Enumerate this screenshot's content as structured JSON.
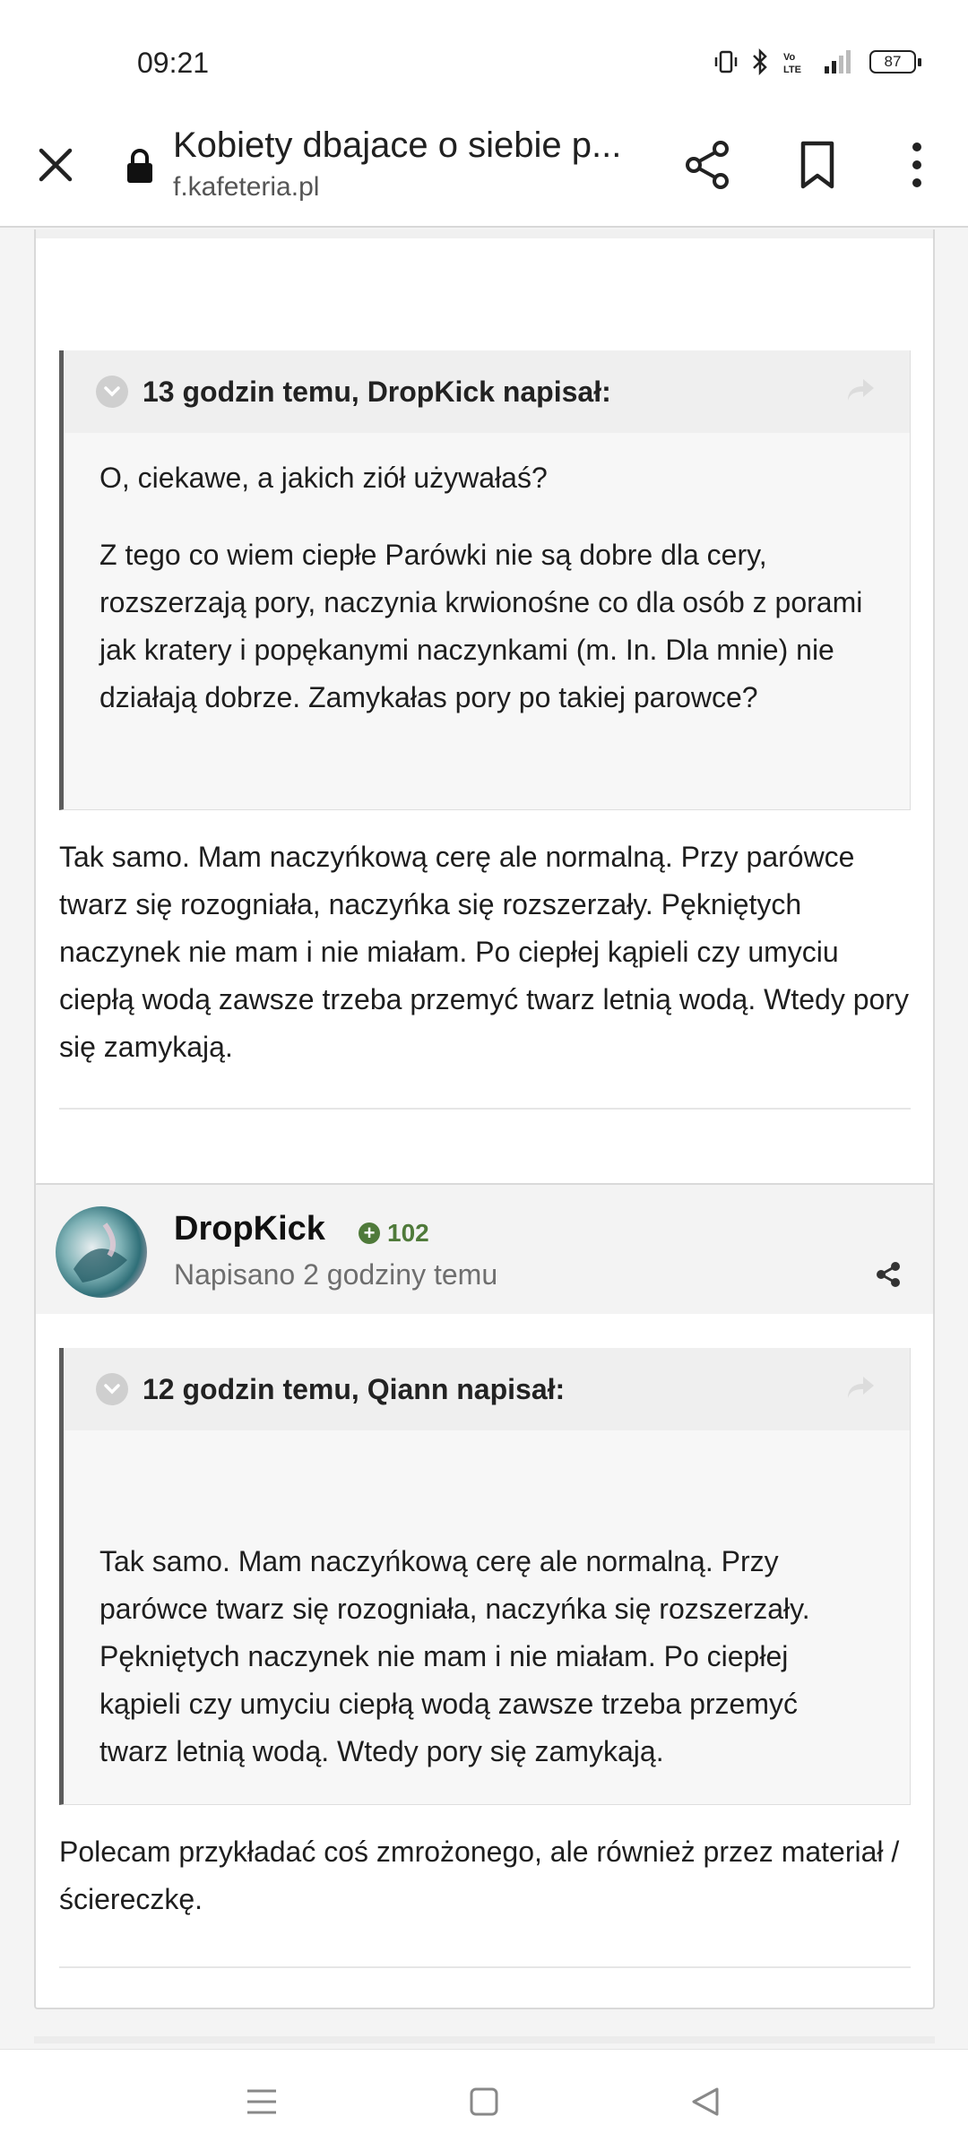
{
  "status": {
    "time": "09:21",
    "battery": "87"
  },
  "browser": {
    "title": "Kobiety dbajace o siebie p...",
    "url": "f.kafeteria.pl"
  },
  "post1": {
    "quote": {
      "citation": "13 godzin temu, DropKick napisał:",
      "paragraphs": [
        "O, ciekawe, a jakich ziół używałaś?",
        "Z tego co wiem ciepłe Parówki nie są dobre dla cery, rozszerzają pory, naczynia krwionośne co dla osób z porami jak kratery i popękanymi naczynkami (m. In. Dla mnie) nie działają dobrze. Zamykałas pory po takiej parowce?"
      ]
    },
    "text": "Tak samo. Mam naczyńkową cerę ale normalną. Przy parówce twarz się rozogniała, naczyńka się rozszerzały. Pękniętych naczynek nie mam i nie miałam. Po ciepłej kąpieli czy umyciu ciepłą wodą zawsze trzeba przemyć twarz letnią wodą. Wtedy pory się zamykają."
  },
  "post2": {
    "author": "DropKick",
    "reputation": "102",
    "posted": "Napisano 2 godziny temu",
    "quote": {
      "citation": "12 godzin temu, Qiann napisał:",
      "paragraphs": [
        "Tak samo. Mam naczyńkową cerę ale normalną. Przy parówce twarz się rozogniała, naczyńka się rozszerzały. Pękniętych naczynek nie mam i nie miałam. Po ciepłej kąpieli czy umyciu ciepłą wodą zawsze trzeba przemyć twarz letnią wodą. Wtedy pory się zamykają."
      ]
    },
    "text": "Polecam przykładać coś zmrożonego, ale również przez materiał / ściereczkę."
  },
  "colors": {
    "reputation": "#4f7a3a",
    "quote_border": "#5c5c5c"
  },
  "icons": [
    "close-icon",
    "lock-icon",
    "share-icon",
    "bookmark-icon",
    "more-icon",
    "chevron-down-icon",
    "reply-icon",
    "menu-icon",
    "home-icon",
    "back-icon"
  ]
}
